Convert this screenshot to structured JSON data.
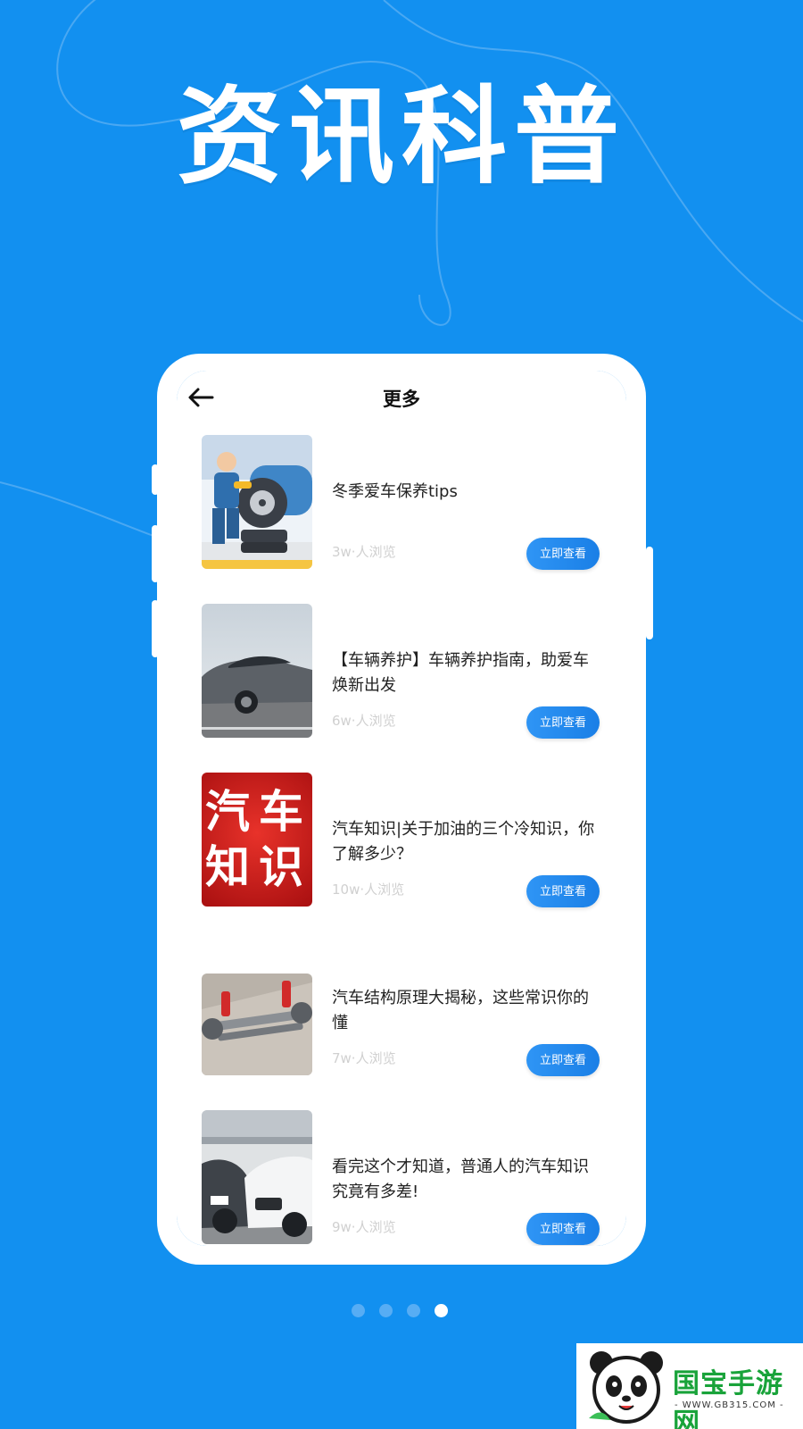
{
  "banner": {
    "title": "资讯科普"
  },
  "nav": {
    "back_icon": "arrow-left-icon",
    "title": "更多"
  },
  "articles": [
    {
      "title": "冬季爱车保养tips",
      "views": "3w·人浏览",
      "button": "立即查看",
      "thumb": "mechanic-tire-illustration"
    },
    {
      "title": "【车辆养护】车辆养护指南，助爱车焕新出发",
      "views": "6w·人浏览",
      "button": "立即查看",
      "thumb": "grey-sedan-photo"
    },
    {
      "title": "汽车知识|关于加油的三个冷知识，你了解多少？",
      "views": "10w·人浏览",
      "button": "立即查看",
      "thumb": "car-knowledge-poster",
      "thumb_text": [
        "汽",
        "车",
        "知",
        "识"
      ]
    },
    {
      "title": "汽车结构原理大揭秘，这些常识你的懂",
      "views": "7w·人浏览",
      "button": "立即查看",
      "thumb": "suspension-diagram"
    },
    {
      "title": "看完这个才知道，普通人的汽车知识究竟有多差!",
      "views": "9w·人浏览",
      "button": "立即查看",
      "thumb": "parked-cars-photo"
    }
  ],
  "pagination": {
    "total": 4,
    "active_index": 3
  },
  "watermark": {
    "brand": "国宝手游网",
    "url": "- WWW.GB315.COM -"
  },
  "colors": {
    "background": "#1290f0",
    "accent": "#1a7fe6",
    "view_count": "#d0d0d0"
  }
}
